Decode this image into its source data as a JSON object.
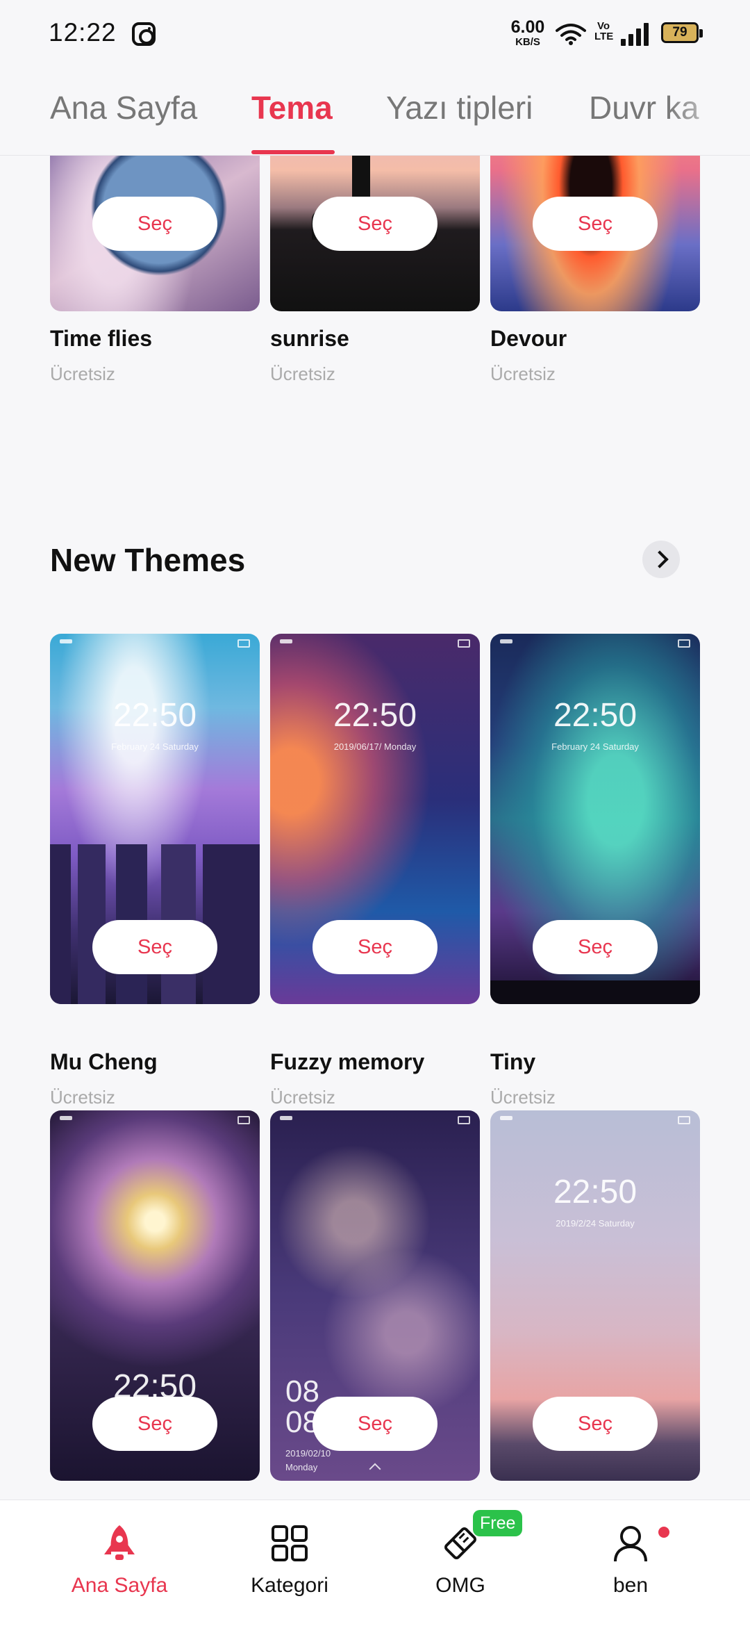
{
  "status_bar": {
    "time": "12:22",
    "speed_value": "6.00",
    "speed_unit": "KB/S",
    "volte_line1": "Vo",
    "volte_line2": "LTE",
    "battery": "79"
  },
  "tabs": [
    {
      "label": "Ana Sayfa",
      "active": false
    },
    {
      "label": "Tema",
      "active": true
    },
    {
      "label": "Yazı tipleri",
      "active": false
    },
    {
      "label": "Duvr ka",
      "active": false
    }
  ],
  "select_label": "Seç",
  "top_row": [
    {
      "title": "Time flies",
      "price": "Ücretsiz"
    },
    {
      "title": "sunrise",
      "price": "Ücretsiz"
    },
    {
      "title": "Devour",
      "price": "Ücretsiz"
    }
  ],
  "section": {
    "title": "New Themes"
  },
  "new_themes": [
    {
      "title": "Mu Cheng",
      "price": "Ücretsiz",
      "clock": "22:50",
      "date": "February  24  Saturday"
    },
    {
      "title": "Fuzzy memory",
      "price": "Ücretsiz",
      "clock": "22:50",
      "date": "2019/06/17/ Monday"
    },
    {
      "title": "Tiny",
      "price": "Ücretsiz",
      "clock": "22:50",
      "date": "February  24  Saturday"
    }
  ],
  "bottom_row": [
    {
      "clock": "22:50"
    },
    {
      "clock_h": "08",
      "clock_m": "08",
      "date": "2019/02/10",
      "day": "Monday"
    },
    {
      "clock": "22:50",
      "date": "2019/2/24 Saturday"
    }
  ],
  "bottom_nav": [
    {
      "label": "Ana Sayfa",
      "icon": "rocket-icon",
      "active": true
    },
    {
      "label": "Kategori",
      "icon": "grid-icon",
      "active": false
    },
    {
      "label": "OMG",
      "icon": "eraser-icon",
      "active": false,
      "badge": "Free"
    },
    {
      "label": "ben",
      "icon": "user-icon",
      "active": false
    }
  ],
  "colors": {
    "accent": "#e8364f",
    "badge": "#2bc24a",
    "background": "#f7f7f9"
  }
}
